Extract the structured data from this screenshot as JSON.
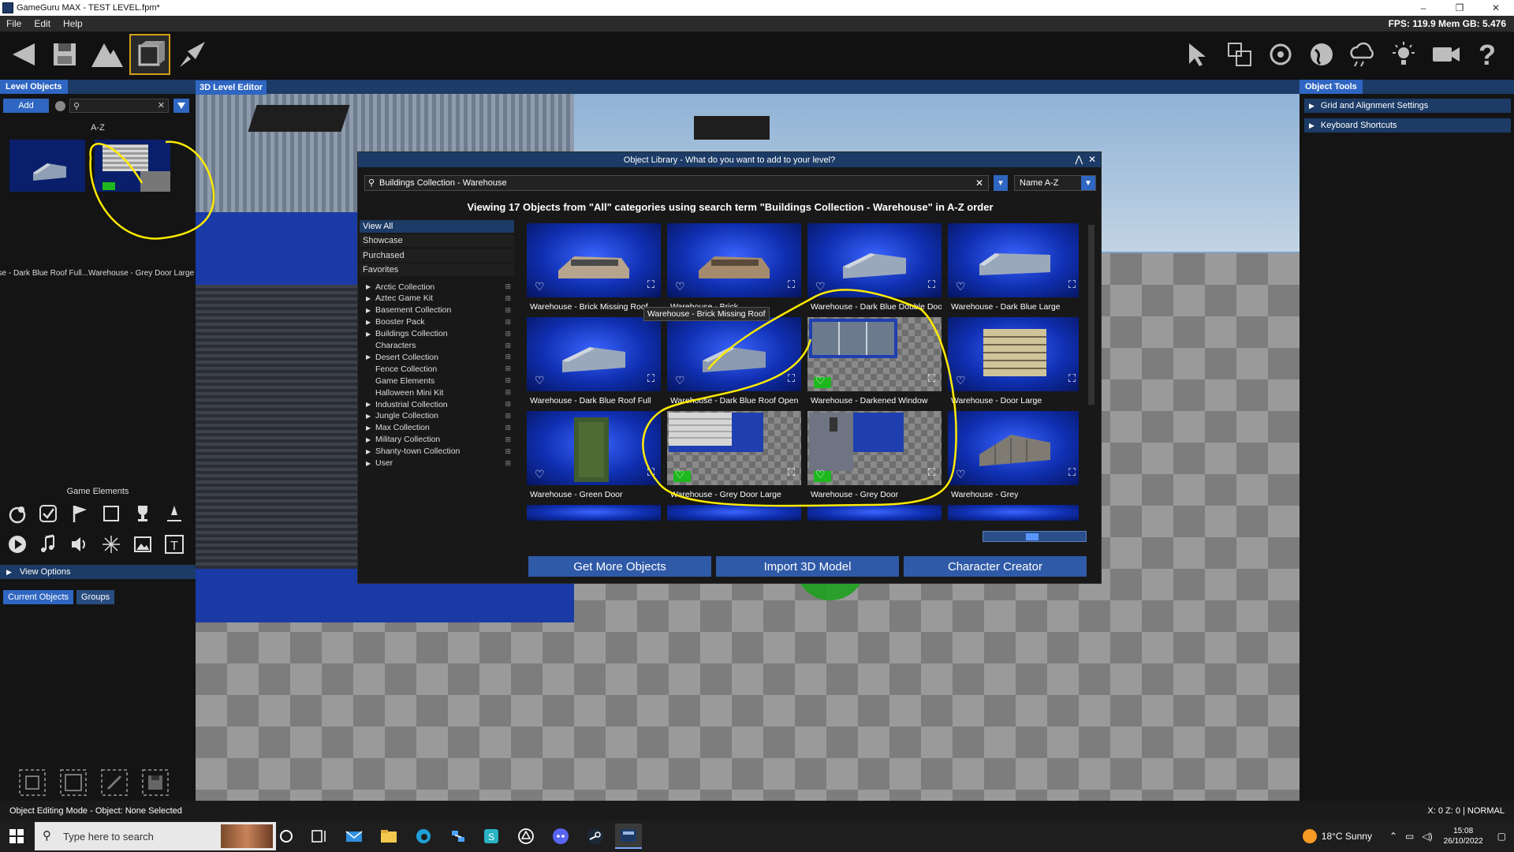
{
  "window": {
    "title": "GameGuru MAX - TEST LEVEL.fpm*"
  },
  "menu": {
    "items": [
      "File",
      "Edit",
      "Help"
    ],
    "fps": "FPS: 119.9 Mem GB: 5.476"
  },
  "left_panel": {
    "tab": "Level Objects",
    "add_label": "Add",
    "search_value": "",
    "sort_label": "A-Z",
    "thumbs": [
      "...ouse - Dark Blue Roof Full",
      "Warehouse - Grey Door Large"
    ],
    "game_elements_title": "Game Elements",
    "view_options": "View Options",
    "tab_current": "Current Objects",
    "tab_groups": "Groups"
  },
  "viewport": {
    "tab": "3D Level Editor"
  },
  "right_panel": {
    "tab": "Object Tools",
    "rows": [
      "Grid and Alignment Settings",
      "Keyboard Shortcuts"
    ]
  },
  "modal": {
    "title": "Object Library - What do you want to add to your level?",
    "search_value": "Buildings Collection - Warehouse",
    "sort_value": "Name A-Z",
    "viewing_text": "Viewing 17 Objects from \"All\" categories using search term \"Buildings Collection - Warehouse\" in A-Z order",
    "top_categories": [
      "View All",
      "Showcase",
      "Purchased",
      "Favorites"
    ],
    "collections": [
      "Arctic Collection",
      "Aztec Game Kit",
      "Basement Collection",
      "Booster Pack",
      "Buildings Collection",
      "Characters",
      "Desert Collection",
      "Fence Collection",
      "Game Elements",
      "Halloween Mini Kit",
      "Industrial Collection",
      "Jungle Collection",
      "Max Collection",
      "Military Collection",
      "Shanty-town Collection",
      "User"
    ],
    "items": [
      "Warehouse - Brick Missing Roof",
      "Warehouse - Brick",
      "Warehouse - Dark Blue Double Door",
      "Warehouse - Dark Blue Large",
      "Warehouse - Dark Blue Roof Full",
      "Warehouse - Dark Blue Roof Open",
      "Warehouse - Darkened Window",
      "Warehouse - Door Large",
      "Warehouse - Green Door",
      "Warehouse - Grey Door Large",
      "Warehouse - Grey Door",
      "Warehouse - Grey"
    ],
    "tooltip": "Warehouse - Brick Missing Roof",
    "btn_get_more": "Get More Objects",
    "btn_import": "Import 3D Model",
    "btn_character": "Character Creator"
  },
  "status": {
    "left": "Object Editing Mode -  Object: None Selected",
    "right": "X: 0 Z: 0 | NORMAL"
  },
  "taskbar": {
    "search_placeholder": "Type here to search",
    "weather": "18°C  Sunny",
    "time": "15:08",
    "date": "26/10/2022"
  }
}
